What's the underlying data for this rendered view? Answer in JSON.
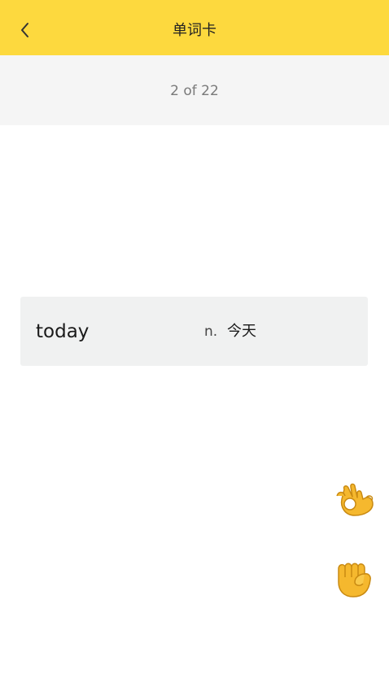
{
  "header": {
    "title": "单词卡",
    "back_icon": "chevron-left-icon",
    "background_color": "#fdd93e"
  },
  "progress": {
    "text": "2 of 22",
    "current": 2,
    "total": 22
  },
  "card": {
    "word": "today",
    "part_of_speech": "n.",
    "meaning": "今天"
  },
  "actions": [
    {
      "icon": "ok-hand-icon"
    },
    {
      "icon": "raised-fist-icon"
    }
  ]
}
